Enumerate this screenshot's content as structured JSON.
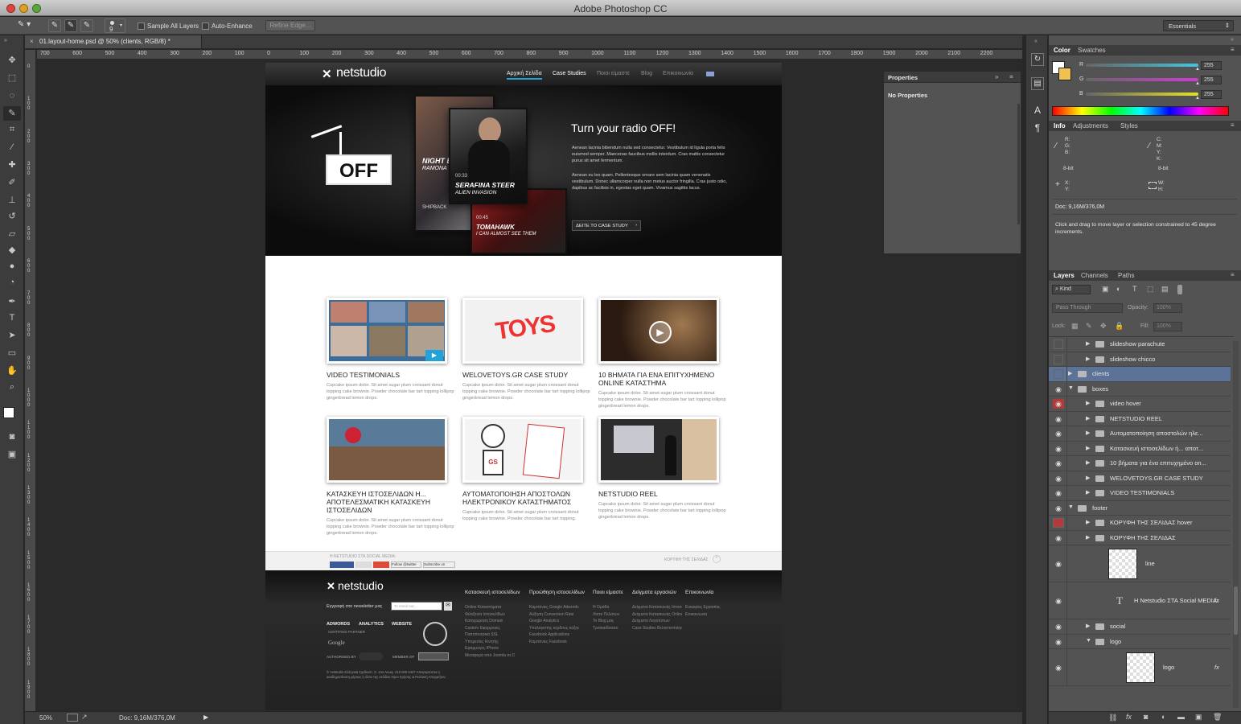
{
  "app": {
    "title": "Adobe Photoshop CC",
    "workspace": "Essentials"
  },
  "options": {
    "brush_size": "9",
    "sample_all_layers": "Sample All Layers",
    "auto_enhance": "Auto-Enhance",
    "refine_edge": "Refine Edge..."
  },
  "document": {
    "tab_label": "01.layout-home.psd @ 50% (clients, RGB/8) *",
    "zoom": "50%",
    "doc_size": "Doc: 9,16M/376,0M",
    "ruler_h": [
      "700",
      "600",
      "500",
      "400",
      "300",
      "200",
      "100",
      "0",
      "100",
      "200",
      "300",
      "400",
      "500",
      "600",
      "700",
      "800",
      "900",
      "1000",
      "1100",
      "1200",
      "1300",
      "1400",
      "1500",
      "1600",
      "1700",
      "1800",
      "1900",
      "2000",
      "2100",
      "2200"
    ],
    "ruler_v": [
      "0",
      "1\n0\n0",
      "2\n0\n0",
      "3\n0\n0",
      "4\n0\n0",
      "5\n0\n0",
      "6\n0\n0",
      "7\n0\n0",
      "8\n0\n0",
      "9\n0\n0",
      "1\n0\n0\n0",
      "1\n1\n0\n0",
      "1\n2\n0\n0",
      "1\n3\n0\n0",
      "1\n4\n0\n0",
      "1\n5\n0\n0",
      "1\n6\n0\n0",
      "1\n7\n0\n0",
      "1\n8\n0\n0",
      "1\n9\n0\n0"
    ]
  },
  "mockup": {
    "logo": "netstudio",
    "nav": [
      "Αρχική Σελίδα",
      "Case Studies",
      "Ποιοι είμαστε",
      "Blog",
      "Επικοινωνία"
    ],
    "hero": {
      "off_sign": "OFF",
      "title": "Turn your radio OFF!",
      "para1": "Aenean lacinia bibendum nulla sed consectetur. Vestibulum id ligula porta felis euismod semper. Maecenas faucibus mollis interdum. Cras mattis consectetur purus sit amet fermentum.",
      "para2": "Aenean eu leo quam. Pellentesque ornare sem lacinia quam venenatis vestibulum. Donec ullamcorper nulla non metus auctor fringilla. Cras justo odio, dapibus ac facilisis in, egestas eget quam. Vivamus sagittis lacus.",
      "cta": "ΔΕΙΤΕ ΤΟ CASE STUDY",
      "posters": [
        {
          "title": "NIGHT BED",
          "sub": "RAMONA"
        },
        {
          "title": "SERAFINA STEER",
          "sub": "ALIEN INVASION",
          "time": "00:33"
        },
        {
          "title": "TOMAHAWK",
          "sub": "I CAN ALMOST SEE THEM",
          "time": "00:45"
        },
        {
          "title": "SHIPBACK",
          "sub": ""
        }
      ]
    },
    "cards": [
      {
        "title": "VIDEO TESTIMONIALS",
        "text": "Cupcake ipsum dolor. Sit amet sugar plum croissant donut topping cake brownie. Powder chocolate bar tart topping lollipop gingerbread lemon drops."
      },
      {
        "title": "WELOVETOYS.GR CASE STUDY",
        "text": "Cupcake ipsum dolor. Sit amet sugar plum croissant donut topping cake brownie. Powder chocolate bar tart topping lollipop gingerbread lemon drops.",
        "logo": "TOYS"
      },
      {
        "title": "10 ΒΗΜΑΤΑ ΓΙΑ ΕΝΑ ΕΠΙΤΥΧΗΜΕΝΟ ONLINE ΚΑΤΑΣΤΗΜΑ",
        "text": "Cupcake ipsum dolor. Sit amet sugar plum croissant donut topping cake brownie. Powder chocolate bar tart topping lollipop gingerbread lemon drops."
      },
      {
        "title": "ΚΑΤΑΣΚΕΥΗ ΙΣΤΟΣΕΛΙΔΩΝ Η... ΑΠΟΤΕΛΕΣΜΑΤΙΚΗ ΚΑΤΑΣΚΕΥΗ ΙΣΤΟΣΕΛΙΔΩΝ",
        "text": "Cupcake ipsum dolor. Sit amet sugar plum croissant donut topping cake brownie. Powder chocolate bar tart topping lollipop gingerbread lemon drops."
      },
      {
        "title": "ΑΥΤΟΜΑΤΟΠΟΙΗΣΗ ΑΠΟΣΤΟΛΩΝ ΗΛΕΚΤΡΟΝΙΚΟΥ ΚΑΤΑΣΤΗΜΑΤΟΣ",
        "text": "Cupcake ipsum dolor. Sit amet sugar plum croissant donut topping cake brownie. Powder chocolate bar tart topping.",
        "logo": "GS"
      },
      {
        "title": "NETSTUDIO REEL",
        "text": "Cupcake ipsum dolor. Sit amet sugar plum croissant donut topping cake brownie. Powder chocolate bar tart topping lollipop gingerbread lemon drops."
      }
    ],
    "social": {
      "label": "Η NETSTUDIO ΣΤΑ SOCIAL MEDIA:",
      "top_link": "ΚΟΡΥΦΗ ΤΗΣ ΣΕΛΙΔΑΣ",
      "follow": "Follow @twitter",
      "subscribe": "Subscribe on"
    },
    "footer": {
      "logo": "netstudio",
      "newsletter": "Εγγραφή στο newsletter μας",
      "email_placeholder": "Το email σας...",
      "badges": [
        "ADWORDS",
        "ANALYTICS",
        "WEBSITE",
        "CERTIFIED PARTNER",
        "Google"
      ],
      "authorised": "AUTHORISED BY",
      "member": "MEMBER OF",
      "copyright": "© netstudio Ελληνικά Σχεδιαστ. Σ. 14ο Λεωφ. 210 600 6447 Απαγορεύεται η αναδημοσίευση μέρους ή όλου της σελίδας Όροι Χρήσης & Πολιτική Απορρήτου",
      "columns": [
        {
          "head": "Κατασκευή ιστοσελίδων",
          "links": [
            "Online Καταστήματα",
            "Φιλοξενία Ιστοσελίδων",
            "Καταχώρηση Domain",
            "Custom Εφαρμογές",
            "Πιστοποιητικά SSL",
            "Υπηρεσίες Κινητής",
            "Εφαρμογές iPhone",
            "Μεταφορά από Joomla σε Drupal"
          ]
        },
        {
          "head": "Προώθηση ιστοσελίδων",
          "links": [
            "Καμπάνιες Google Adwords",
            "Αύξηση Conversion Rate",
            "Google Analytics",
            "Υπολογιστής κέρδους αύξησης conversion rate",
            "Facebook Applications",
            "Καμπάνιες Facebook"
          ]
        },
        {
          "head": "Ποιοι είμαστε",
          "links": [
            "Η Ομάδα",
            "Λίστα Πελατών",
            "Το Blog μας",
            "Τρισκαιδέκατο"
          ]
        },
        {
          "head": "Δείγματα εργασιών",
          "links": [
            "Δείγματα Κατασκευής Ιστοσελίδων",
            "Δείγματα Κατασκευής Online Καταστημάτων",
            "Δείγματα Λογοτύπων",
            "Case Studies Βελτιστοποίησης Conversion Rate"
          ]
        },
        {
          "head": "Επικοινωνία",
          "links": [
            "Ευκαιρίες Εργασίας",
            "Επικοινωνία"
          ]
        }
      ]
    }
  },
  "properties": {
    "title": "Properties",
    "empty": "No Properties"
  },
  "color_panel": {
    "tabs": [
      "Color",
      "Swatches"
    ],
    "channels": [
      {
        "label": "R",
        "value": "255",
        "color": "#3ec6e0"
      },
      {
        "label": "G",
        "value": "255",
        "color": "#d23ad6"
      },
      {
        "label": "B",
        "value": "255",
        "color": "#e6e21e"
      }
    ]
  },
  "info_panel": {
    "tabs": [
      "Info",
      "Adjustments",
      "Styles"
    ],
    "rgb": "R:\nG:\nB:",
    "cmyk": "C:\nM:\nY:\nK:",
    "bit_left": "8-bit",
    "bit_right": "8-bit",
    "xy": "X:\nY:",
    "wh": "W:\nH:",
    "doc": "Doc: 9,16M/376,0M",
    "hint": "Click and drag to move layer or selection constrained to 45 degree increments."
  },
  "layers_panel": {
    "tabs": [
      "Layers",
      "Channels",
      "Paths"
    ],
    "kind": "Kind",
    "blend": "Pass Through",
    "opacity_label": "Opacity:",
    "opacity": "100%",
    "lock_label": "Lock:",
    "fill_label": "Fill:",
    "fill": "100%",
    "layers": [
      {
        "name": "slideshow parachute",
        "type": "folder",
        "depth": 2,
        "eye": false
      },
      {
        "name": "slideshow chicco",
        "type": "folder",
        "depth": 2,
        "eye": false
      },
      {
        "name": "clients",
        "type": "folder",
        "depth": 1,
        "eye": false,
        "selected": true
      },
      {
        "name": "boxes",
        "type": "folder",
        "depth": 1,
        "eye": true,
        "open": true
      },
      {
        "name": "video hover",
        "type": "folder",
        "depth": 2,
        "eye": true,
        "red": true
      },
      {
        "name": "NETSTUDIO REEL",
        "type": "folder",
        "depth": 2,
        "eye": true
      },
      {
        "name": "Αυτοματοποίηση αποστολών ηλε...",
        "type": "folder",
        "depth": 2,
        "eye": true
      },
      {
        "name": "Κατασκευή ιστοσελίδων ή... αποτ...",
        "type": "folder",
        "depth": 2,
        "eye": true
      },
      {
        "name": "10 βήματα για ένα επιτυχημένο on...",
        "type": "folder",
        "depth": 2,
        "eye": true
      },
      {
        "name": "WELOVETOYS.GR CASE STUDY",
        "type": "folder",
        "depth": 2,
        "eye": true
      },
      {
        "name": "VIDEO TESTIMONIALS",
        "type": "folder",
        "depth": 2,
        "eye": true
      },
      {
        "name": "footer",
        "type": "folder",
        "depth": 1,
        "eye": true,
        "open": true
      },
      {
        "name": "ΚΟΡΥΦΗ ΤΗΣ ΣΕΛΙΔΑΣ hover",
        "type": "folder",
        "depth": 2,
        "eye": false,
        "red": true
      },
      {
        "name": "ΚΟΡΥΦΗ ΤΗΣ ΣΕΛΙΔΑΣ",
        "type": "folder",
        "depth": 2,
        "eye": true
      },
      {
        "name": "line",
        "type": "thumb",
        "depth": 2,
        "eye": true
      },
      {
        "name": "H Netstudio ΣΤΑ Social MEDIA:",
        "type": "text",
        "depth": 2,
        "eye": true,
        "fx": true
      },
      {
        "name": "social",
        "type": "folder",
        "depth": 2,
        "eye": true
      },
      {
        "name": "logo",
        "type": "folder",
        "depth": 2,
        "eye": true,
        "open": true
      },
      {
        "name": "logo",
        "type": "thumb",
        "depth": 3,
        "eye": true,
        "fx": true
      }
    ]
  }
}
